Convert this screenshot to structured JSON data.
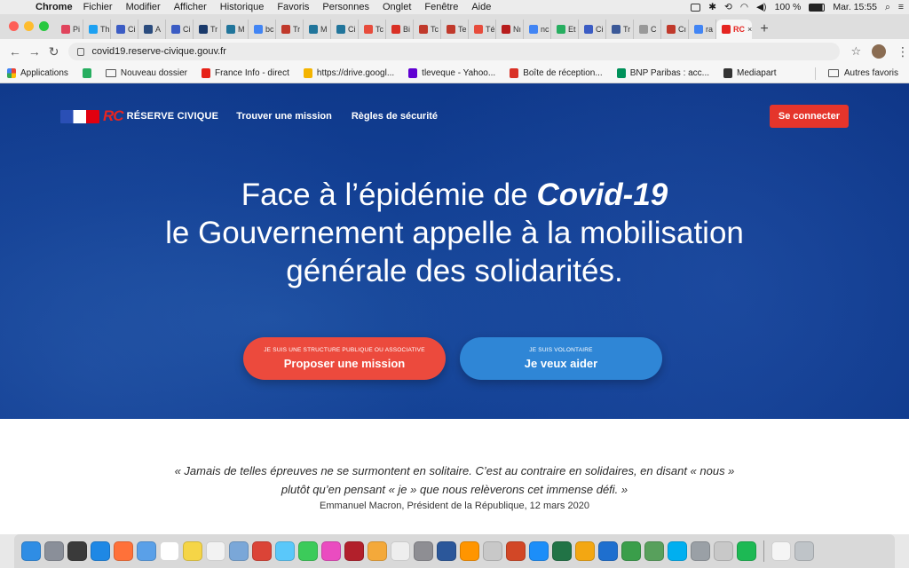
{
  "menubar": {
    "app": "Chrome",
    "items": [
      "Fichier",
      "Modifier",
      "Afficher",
      "Historique",
      "Favoris",
      "Personnes",
      "Onglet",
      "Fenêtre",
      "Aide"
    ],
    "battery": "100 %",
    "clock": "Mar. 15:55"
  },
  "tabs": [
    {
      "label": "Pi",
      "color": "#e0445c"
    },
    {
      "label": "Th",
      "color": "#1da1f2"
    },
    {
      "label": "Ci",
      "color": "#3b5cc4"
    },
    {
      "label": "A",
      "color": "#2b4c7e"
    },
    {
      "label": "Ci",
      "color": "#3b5cc4"
    },
    {
      "label": "Tr",
      "color": "#1a3a6b"
    },
    {
      "label": "M",
      "color": "#21759b"
    },
    {
      "label": "bc",
      "color": "#4285f4"
    },
    {
      "label": "Tr",
      "color": "#c0392b"
    },
    {
      "label": "M",
      "color": "#21759b"
    },
    {
      "label": "Ci",
      "color": "#21759b"
    },
    {
      "label": "Tc",
      "color": "#e74c3c"
    },
    {
      "label": "Bi",
      "color": "#d93025"
    },
    {
      "label": "Tc",
      "color": "#c0392b"
    },
    {
      "label": "Te",
      "color": "#c0392b"
    },
    {
      "label": "Té",
      "color": "#e74c3c"
    },
    {
      "label": "Nı",
      "color": "#b71c1c"
    },
    {
      "label": "nc",
      "color": "#4285f4"
    },
    {
      "label": "Et",
      "color": "#27ae60"
    },
    {
      "label": "Ci",
      "color": "#3b5cc4"
    },
    {
      "label": "Tr",
      "color": "#3b5998"
    },
    {
      "label": "C",
      "color": "#999999"
    },
    {
      "label": "Cı",
      "color": "#c0392b"
    },
    {
      "label": "ra",
      "color": "#4285f4"
    }
  ],
  "active_tab": {
    "label": "RC",
    "color": "#e52521"
  },
  "toolbar": {
    "url": "covid19.reserve-civique.gouv.fr"
  },
  "bookmarks": [
    {
      "label": "Applications",
      "color": "#e74c3c",
      "type": "apps"
    },
    {
      "label": "",
      "color": "#27ae60",
      "type": "icon"
    },
    {
      "label": "Nouveau dossier",
      "color": "#555555",
      "type": "folder"
    },
    {
      "label": "France Info - direct",
      "color": "#e62117",
      "type": "icon"
    },
    {
      "label": "https://drive.googl...",
      "color": "#f4b400",
      "type": "icon"
    },
    {
      "label": "tleveque - Yahoo...",
      "color": "#6001d2",
      "type": "icon"
    },
    {
      "label": "Boîte de réception...",
      "color": "#d93025",
      "type": "icon"
    },
    {
      "label": "BNP Paribas : acc...",
      "color": "#00915a",
      "type": "icon"
    },
    {
      "label": "Mediapart",
      "color": "#333333",
      "type": "icon"
    }
  ],
  "bookmarks_right": "Autres favoris",
  "site": {
    "logo_rc": "RC",
    "logo_text": "RÉSERVE CIVIQUE",
    "nav": [
      "Trouver une mission",
      "Règles de sécurité"
    ],
    "connect": "Se connecter",
    "headline": {
      "prefix": "Face à l’épidémie de ",
      "emph": "Covid-19",
      "line2": "le Gouvernement appelle à la mobilisation",
      "line3": "générale des solidarités."
    },
    "cta_mission": {
      "small": "Je suis une structure publique ou associative",
      "big": "Proposer une mission"
    },
    "cta_volunteer": {
      "small": "Je suis volontaire",
      "big": "Je veux aider"
    },
    "quote": "« Jamais de telles épreuves ne se surmontent en solitaire. C’est au contraire en solidaires, en disant « nous » plutôt qu’en pensant « je » que nous relèverons cet immense défi. »",
    "author": "Emmanuel Macron, Président de la République, 12 mars 2020"
  },
  "dock": [
    {
      "name": "finder-icon",
      "color": "#2f8de4"
    },
    {
      "name": "launchpad-icon",
      "color": "#8a8f99"
    },
    {
      "name": "mission-control-icon",
      "color": "#3a3a3a"
    },
    {
      "name": "safari-icon",
      "color": "#1e88e5"
    },
    {
      "name": "firefox-icon",
      "color": "#ff7139"
    },
    {
      "name": "mail-icon",
      "color": "#5aa0e8"
    },
    {
      "name": "calendar-icon",
      "color": "#ffffff"
    },
    {
      "name": "notes-icon",
      "color": "#f5d547"
    },
    {
      "name": "reminders-icon",
      "color": "#f2f2f2"
    },
    {
      "name": "preview-icon",
      "color": "#7aa7d8"
    },
    {
      "name": "chrome-icon",
      "color": "#db4437"
    },
    {
      "name": "messages-icon",
      "color": "#5ac8fa"
    },
    {
      "name": "facetime-icon",
      "color": "#3ccb5a"
    },
    {
      "name": "itunes-icon",
      "color": "#ea4cc0"
    },
    {
      "name": "photo-booth-icon",
      "color": "#b2202b"
    },
    {
      "name": "photos-icon",
      "color": "#f4a93a"
    },
    {
      "name": "textedit-icon",
      "color": "#eeeeee"
    },
    {
      "name": "system-preferences-icon",
      "color": "#8e8e93"
    },
    {
      "name": "word-icon",
      "color": "#2b579a"
    },
    {
      "name": "books-icon",
      "color": "#ff9500"
    },
    {
      "name": "unknown-app-icon",
      "color": "#c8c8c8"
    },
    {
      "name": "powerpoint-icon",
      "color": "#d24726"
    },
    {
      "name": "app-store-icon",
      "color": "#1c8ef9"
    },
    {
      "name": "excel-icon",
      "color": "#217346"
    },
    {
      "name": "outlook-icon",
      "color": "#f3a712"
    },
    {
      "name": "cyberduck-icon",
      "color": "#1e6fcf"
    },
    {
      "name": "contacts-icon",
      "color": "#3a9e4a"
    },
    {
      "name": "globe-icon",
      "color": "#58a05c"
    },
    {
      "name": "skype-icon",
      "color": "#00aff0"
    },
    {
      "name": "satellite-icon",
      "color": "#9aa0a6"
    },
    {
      "name": "unknown-app-icon-2",
      "color": "#c8c8c8"
    },
    {
      "name": "spotify-icon",
      "color": "#1db954"
    },
    {
      "name": "document-icon",
      "color": "#f5f5f5"
    },
    {
      "name": "trash-icon",
      "color": "#bfc4c8"
    }
  ]
}
